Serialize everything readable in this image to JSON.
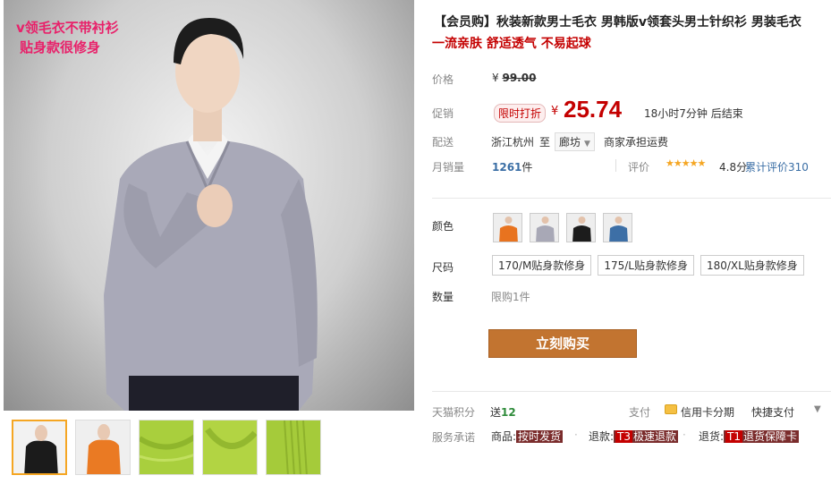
{
  "gallery": {
    "overlay_line1": "v领毛衣不带衬衫",
    "overlay_line2": "贴身款很修身",
    "thumbnails": [
      "black-sweater",
      "orange-sweater",
      "green-fabric-collar",
      "green-fabric-neck",
      "green-fabric-cuff"
    ]
  },
  "product": {
    "title": "【会员购】秋装新款男士毛衣 男韩版v领套头男士针织衫 男装毛衣",
    "subtitle": "一流亲肤 舒适透气 不易起球"
  },
  "price": {
    "label": "价格",
    "currency": "¥",
    "original": "99.00"
  },
  "promo": {
    "label": "促销",
    "badge": "限时打折",
    "currency": "¥",
    "price": "25.74",
    "countdown": "18小时7分钟 后结束"
  },
  "shipping": {
    "label": "配送",
    "from": "浙江杭州",
    "to_word": "至",
    "destination": "廊坊",
    "fee": "商家承担运费"
  },
  "sales": {
    "label": "月销量",
    "count": "1261",
    "unit": "件",
    "rating_label": "评价",
    "stars": "★★★★★",
    "rating_value": "4.8分",
    "review_link": "累计评价310"
  },
  "options": {
    "color_label": "颜色",
    "colors": [
      "orange",
      "grey",
      "black",
      "blue"
    ],
    "size_label": "尺码",
    "sizes": [
      "170/M贴身款修身",
      "175/L贴身款修身",
      "180/XL贴身款修身"
    ],
    "qty_label": "数量",
    "qty_limit": "限购1件"
  },
  "buy_button": "立刻购买",
  "points": {
    "label": "天猫积分",
    "give": "送",
    "value": "12"
  },
  "payment": {
    "label": "支付",
    "card": "信用卡分期",
    "quick": "快捷支付"
  },
  "service": {
    "label": "服务承诺",
    "item1_prefix": "商品:",
    "item1_tag": "按时发货",
    "item2_prefix": "退款:",
    "item2_code": "T3",
    "item2_tag": "极速退款",
    "item3_prefix": "退货:",
    "item3_code": "T1",
    "item3_tag": "退货保障卡",
    "separator": "·"
  },
  "colors": {
    "price_red": "#c40000",
    "buy_button": "#c27430",
    "link_blue": "#3a6ea5",
    "overlay_pink": "#e8216a",
    "star": "#f5a623"
  }
}
